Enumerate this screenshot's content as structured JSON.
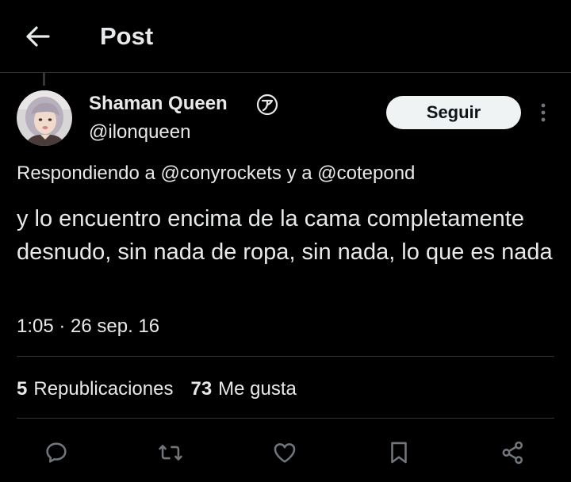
{
  "header": {
    "title": "Post",
    "back_icon": "arrow-left-icon"
  },
  "author": {
    "name": "Shaman Queen",
    "handle": "@ilonqueen",
    "badge_glyph": "ア",
    "follow_label": "Seguir",
    "more_icon": "more-vertical-icon"
  },
  "tweet": {
    "reply_prefix": "Respondiendo a ",
    "mention_1": "@conyrockets",
    "reply_connector": " y a ",
    "mention_2": "@cotepond",
    "text": "y lo encuentro encima de la cama completamente desnudo, sin nada de ropa, sin nada, lo que es nada",
    "timestamp": "1:05 · 26 sep. 16"
  },
  "stats": {
    "reposts_count": "5",
    "reposts_label": "Republicaciones",
    "likes_count": "73",
    "likes_label": "Me gusta"
  },
  "actions": [
    {
      "name": "reply-icon"
    },
    {
      "name": "repost-icon"
    },
    {
      "name": "like-icon"
    },
    {
      "name": "bookmark-icon"
    },
    {
      "name": "share-icon"
    }
  ],
  "colors": {
    "background": "#000000",
    "text": "#e7e9ea",
    "divider": "#2f3336",
    "icon": "#71767b",
    "button_bg": "#eff3f4",
    "button_text": "#0f1419"
  }
}
